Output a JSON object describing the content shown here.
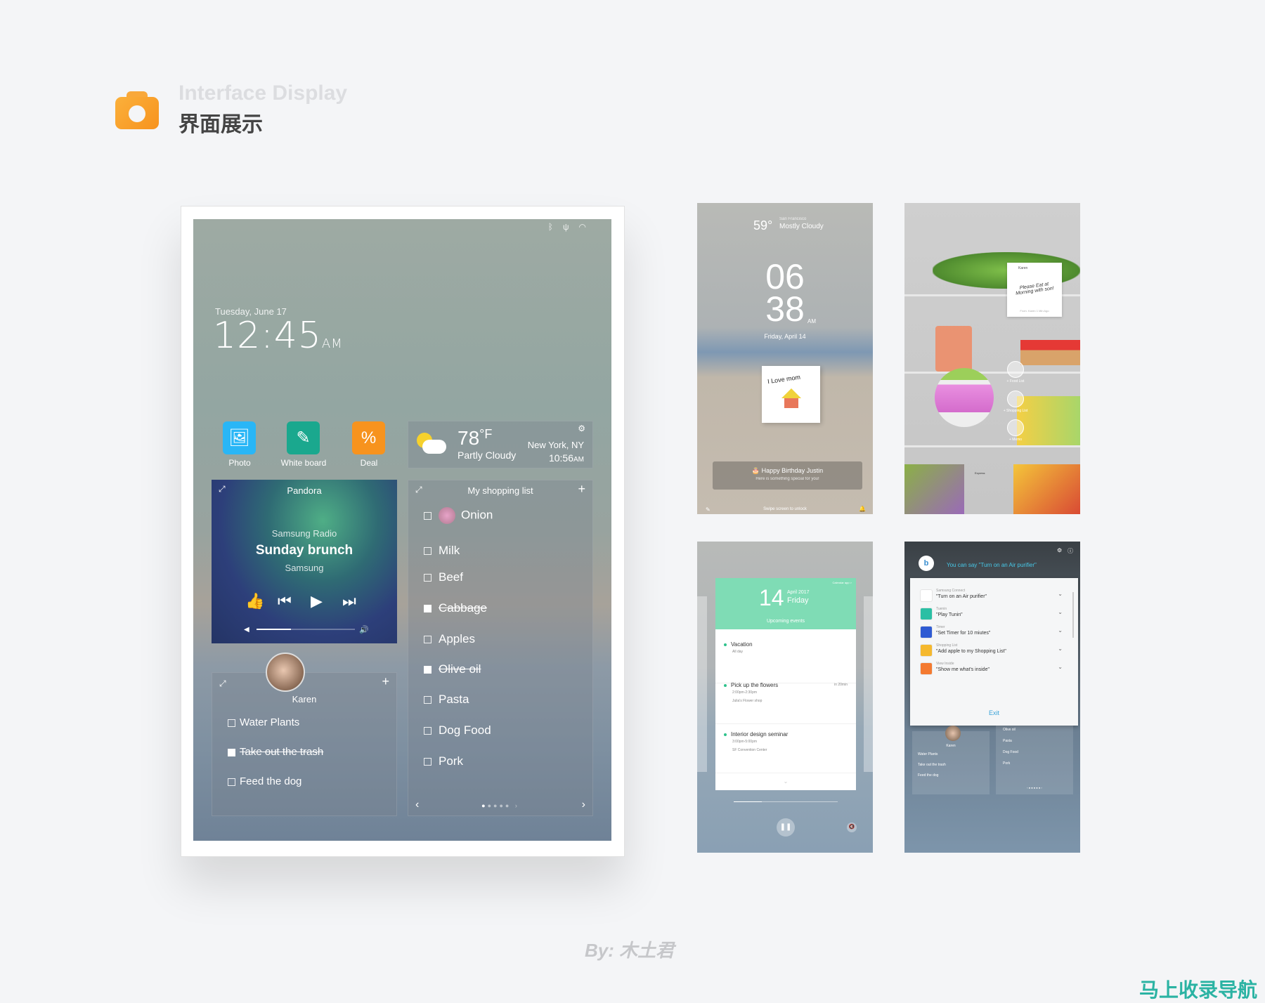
{
  "header": {
    "title_en": "Interface Display",
    "title_cn": "界面展示",
    "icon": "camera-icon",
    "accent": "#f7931e"
  },
  "main": {
    "status_icons": [
      "bluetooth-icon",
      "usb-icon",
      "wifi-icon"
    ],
    "date": "Tuesday, June 17",
    "time": "12:45",
    "ampm": "AM",
    "apps": [
      {
        "label": "Photo",
        "icon": "image-icon",
        "color": "#29b6f6"
      },
      {
        "label": "White board",
        "icon": "whiteboard-icon",
        "color": "#1aa88e"
      },
      {
        "label": "Deal",
        "icon": "percent-badge-icon",
        "color": "#f7931e"
      }
    ],
    "weather": {
      "temp": "78",
      "unit": "°F",
      "condition": "Partly Cloudy",
      "city": "New York, NY",
      "time": "10:56",
      "ampm": "AM"
    },
    "pandora": {
      "title": "Pandora",
      "station": "Samsung Radio",
      "song": "Sunday brunch",
      "artist": "Samsung",
      "volume": 0.35
    },
    "shopping": {
      "title": "My shopping list",
      "items": [
        {
          "label": "Onion",
          "checked": false
        },
        {
          "label": "Milk",
          "checked": false
        },
        {
          "label": "Beef",
          "checked": false
        },
        {
          "label": "Cabbage",
          "checked": true
        },
        {
          "label": "Apples",
          "checked": false
        },
        {
          "label": "Olive oil",
          "checked": true
        },
        {
          "label": "Pasta",
          "checked": false
        },
        {
          "label": "Dog Food",
          "checked": false
        },
        {
          "label": "Pork",
          "checked": false
        }
      ],
      "page": 1,
      "pages": 5
    },
    "memo": {
      "name": "Karen",
      "tasks": [
        {
          "label": "Water Plants",
          "checked": false
        },
        {
          "label": "Take out the trash",
          "checked": true
        },
        {
          "label": "Feed the dog",
          "checked": false
        }
      ]
    }
  },
  "lock": {
    "temp": "59°",
    "city": "San Francisco",
    "condition": "Mostly Cloudy",
    "hour": "06",
    "minute": "38",
    "ampm": "AM",
    "date": "Friday, April 14",
    "note": "I Love mom",
    "banner_title": "Happy Birthday Justin",
    "banner_sub": "Here is something special for you!",
    "unlock": "Swipe screen to unlock"
  },
  "fridge": {
    "note_from": "Karen",
    "note_text": "Please Eat at Morning with son!",
    "note_meta": "From. Karen 1 Min Ago",
    "actions": [
      "+ Food List",
      "+ Shopping List",
      "+ Memo"
    ],
    "drawer_label": "Express"
  },
  "calendar": {
    "link": "Calendar app >",
    "day": "14",
    "month": "April 2017",
    "weekday": "Friday",
    "subtitle": "Upcoming events",
    "events": [
      {
        "title": "Vacation",
        "time": "All day",
        "place": "",
        "due": ""
      },
      {
        "title": "Pick up the flowers",
        "time": "2:00pm-2:30pm",
        "place": "Julia's Flower shop",
        "due": "in 20min"
      },
      {
        "title": "Interior design seminar",
        "time": "3:00pm-5:00pm",
        "place": "SF Convention Center",
        "due": ""
      }
    ],
    "accent": "#7fdcb5"
  },
  "voice": {
    "prompt": "You can say \"Turn on an Air purifier\"",
    "items": [
      {
        "app": "Samsung Connect",
        "cmd": "\"Turn on an Air purifier\"",
        "color": "#ffffff",
        "icon": "snowflake-icon"
      },
      {
        "app": "Tuenin",
        "cmd": "\"Play Tunin\"",
        "color": "#2bbfa4",
        "icon": "plus-icon"
      },
      {
        "app": "Timer",
        "cmd": "\"Set Timer for 10 miutes\"",
        "color": "#2f5bd3",
        "icon": "timer-icon"
      },
      {
        "app": "Shopping List",
        "cmd": "\"Add apple to my Shopping List\"",
        "color": "#f5b82e",
        "icon": "list-icon"
      },
      {
        "app": "View Inside",
        "cmd": "\"Show me what's inside\"",
        "color": "#f47a30",
        "icon": "fridge-icon"
      }
    ],
    "exit": "Exit",
    "bg_name": "Karen",
    "bg_tasks": [
      "Water Plants",
      "Take out the trash",
      "Feed the dog"
    ],
    "bg_items": [
      "Olive oil",
      "Pasta",
      "Dog Food",
      "Pork"
    ]
  },
  "footer": {
    "credit": "By: 木土君",
    "watermark": "马上收录导航"
  }
}
